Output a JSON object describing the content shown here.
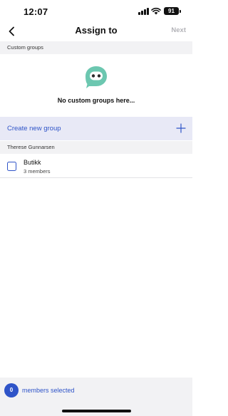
{
  "status_bar": {
    "time": "12:07",
    "battery": "91"
  },
  "nav": {
    "title": "Assign to",
    "next_label": "Next",
    "back_icon": "chevron-left-icon"
  },
  "custom_groups": {
    "header": "Custom groups",
    "empty_icon": "chat-bot-icon",
    "empty_text": "No custom groups here..."
  },
  "create_group": {
    "label": "Create new group",
    "icon": "plus-icon"
  },
  "owner_section": {
    "header": "Therese Gunnarsen",
    "groups": [
      {
        "name": "Butikk",
        "members": "3 members",
        "checked": false
      }
    ]
  },
  "footer": {
    "selected_count": "0",
    "selected_label": "members selected"
  },
  "colors": {
    "accent": "#2f54c8",
    "icon_teal": "#6cc7b0",
    "section_bg": "#f2f2f4",
    "create_bg": "#e8e9f6",
    "disabled_text": "#b3b3b8"
  }
}
